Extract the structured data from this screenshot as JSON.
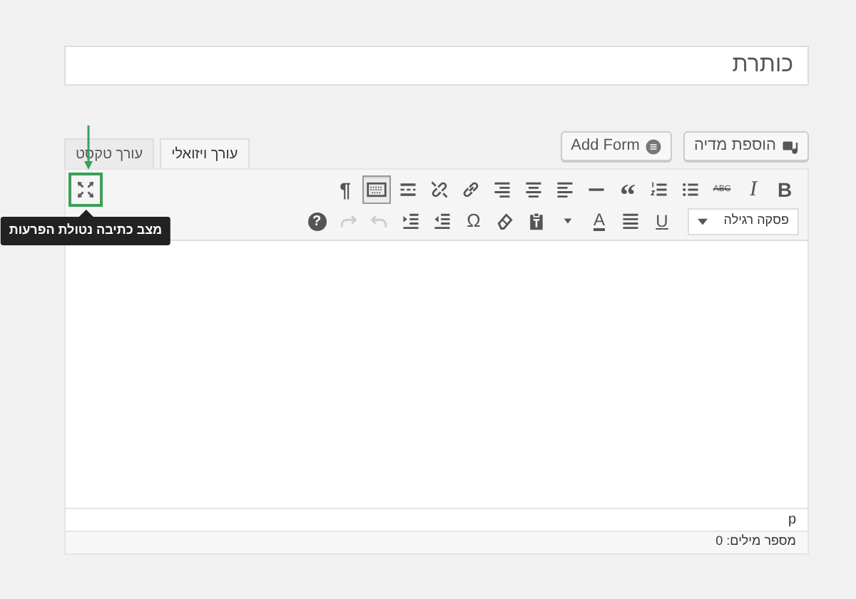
{
  "title_field": {
    "placeholder": "כותרת"
  },
  "media_buttons": [
    {
      "kind": "media",
      "label": "הוספת מדיה"
    },
    {
      "kind": "form",
      "label": "Add Form"
    }
  ],
  "editor_tabs": [
    {
      "label": "עורך ויזואלי",
      "selected": true
    },
    {
      "label": "עורך טקסט",
      "selected": false
    }
  ],
  "toolbar": {
    "row_1": [
      {
        "kind": "bold",
        "glyph": "B",
        "pressed": false
      },
      {
        "kind": "italic",
        "glyph": "I",
        "pressed": false
      },
      {
        "kind": "strike",
        "glyph": "ABC",
        "pressed": false
      },
      {
        "kind": "bullist",
        "pressed": false
      },
      {
        "kind": "numlist",
        "pressed": false
      },
      {
        "kind": "quote",
        "glyph": "“",
        "pressed": false
      },
      {
        "kind": "hr",
        "pressed": false
      },
      {
        "kind": "alignleft",
        "pressed": false
      },
      {
        "kind": "aligncenter",
        "pressed": false
      },
      {
        "kind": "alignright",
        "pressed": false
      },
      {
        "kind": "link",
        "pressed": false
      },
      {
        "kind": "unlink",
        "pressed": false
      },
      {
        "kind": "more",
        "pressed": false
      },
      {
        "kind": "toolbar",
        "pressed": true
      },
      {
        "kind": "direction",
        "glyph": "¶",
        "pressed": false
      },
      {
        "kind": "fullscreen",
        "pressed": false,
        "highlighted": true,
        "tooltip": "מצב כתיבה נטולת הפרעות"
      }
    ],
    "format_select": {
      "value": "פסקה רגילה"
    },
    "row_2": [
      {
        "kind": "underline",
        "glyph": "U",
        "disabled": false
      },
      {
        "kind": "justify",
        "disabled": false
      },
      {
        "kind": "textcolor",
        "glyph": "A",
        "disabled": false
      },
      {
        "kind": "colorcaret",
        "disabled": false
      },
      {
        "kind": "pastetext",
        "disabled": false
      },
      {
        "kind": "eraser",
        "disabled": false
      },
      {
        "kind": "charmap",
        "glyph": "Ω",
        "disabled": false
      },
      {
        "kind": "outdent",
        "disabled": false
      },
      {
        "kind": "indent",
        "disabled": false
      },
      {
        "kind": "undo",
        "disabled": true
      },
      {
        "kind": "redo",
        "disabled": true
      },
      {
        "kind": "help",
        "glyph": "?",
        "disabled": false
      }
    ]
  },
  "path": "p",
  "word_count": "מספר מילים: 0"
}
